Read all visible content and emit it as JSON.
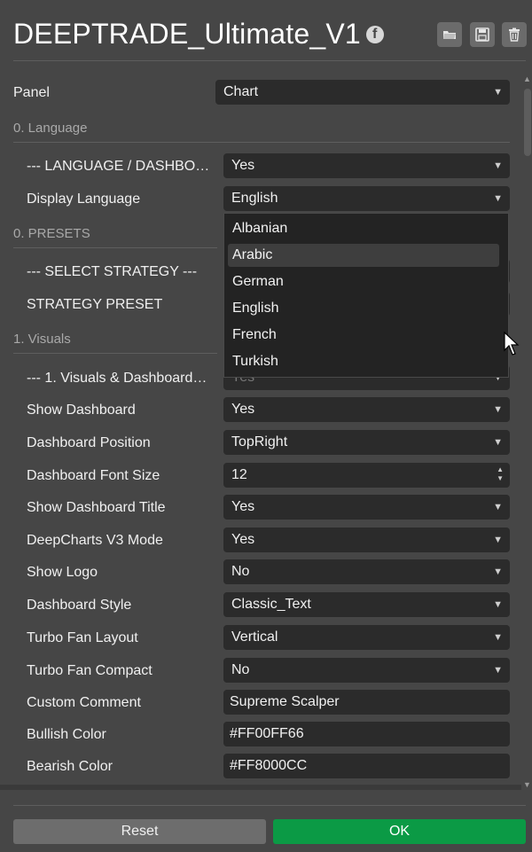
{
  "header": {
    "title": "DEEPTRADE_Ultimate_V1",
    "icons": [
      "facebook-icon",
      "folder-open-icon",
      "save-icon",
      "trash-icon"
    ]
  },
  "panel": {
    "label": "Panel",
    "value": "Chart"
  },
  "sections": {
    "language": "0. Language",
    "presets": "0. PRESETS",
    "visuals": "1. Visuals"
  },
  "rows": {
    "lang_dash": {
      "label": "--- LANGUAGE / DASHBO…",
      "value": "Yes"
    },
    "display_lang": {
      "label": "Display Language",
      "value": "English"
    },
    "select_strategy": {
      "label": "--- SELECT STRATEGY ---"
    },
    "strategy_preset": {
      "label": "STRATEGY PRESET"
    },
    "visuals_dash": {
      "label": "--- 1. Visuals & Dashboard…",
      "value": "Yes"
    },
    "show_dashboard": {
      "label": "Show Dashboard",
      "value": "Yes"
    },
    "dash_position": {
      "label": "Dashboard Position",
      "value": "TopRight"
    },
    "dash_font": {
      "label": "Dashboard Font Size",
      "value": "12"
    },
    "show_title": {
      "label": "Show Dashboard Title",
      "value": "Yes"
    },
    "deepcharts": {
      "label": "DeepCharts V3 Mode",
      "value": "Yes"
    },
    "show_logo": {
      "label": "Show Logo",
      "value": "No"
    },
    "dash_style": {
      "label": "Dashboard Style",
      "value": "Classic_Text"
    },
    "fan_layout": {
      "label": "Turbo Fan Layout",
      "value": "Vertical"
    },
    "fan_compact": {
      "label": "Turbo Fan Compact",
      "value": "No"
    },
    "comment": {
      "label": "Custom Comment",
      "value": "Supreme Scalper"
    },
    "bull_color": {
      "label": "Bullish Color",
      "value": "#FF00FF66"
    },
    "bear_color": {
      "label": "Bearish Color",
      "value": "#FF8000CC"
    }
  },
  "dropdown": {
    "options": [
      "Albanian",
      "Arabic",
      "German",
      "English",
      "French",
      "Turkish"
    ],
    "highlighted": "Arabic"
  },
  "footer": {
    "reset": "Reset",
    "ok": "OK"
  },
  "colors": {
    "background": "#464646",
    "field": "#2b2b2b",
    "ok": "#0b9a45",
    "reset": "#6d6d6d"
  }
}
